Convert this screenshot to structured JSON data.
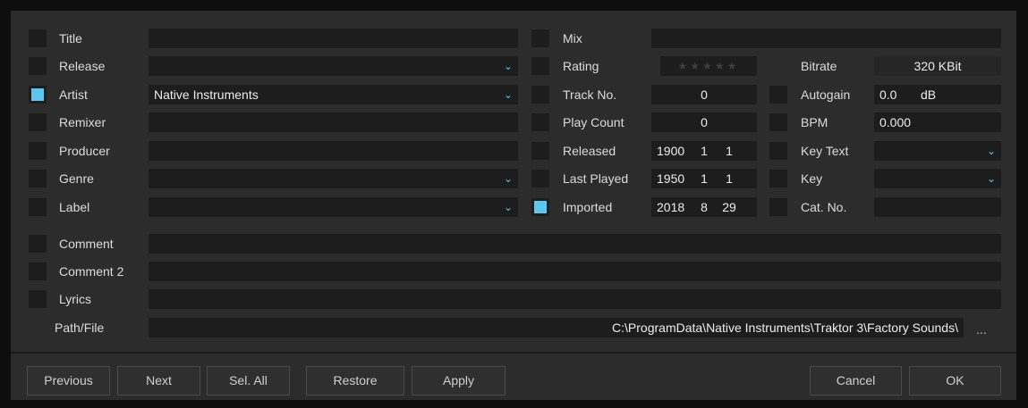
{
  "left_fields": [
    {
      "label": "Title",
      "value": "",
      "checked": false,
      "dropdown": false
    },
    {
      "label": "Release",
      "value": "",
      "checked": false,
      "dropdown": true
    },
    {
      "label": "Artist",
      "value": "Native Instruments",
      "checked": true,
      "dropdown": true
    },
    {
      "label": "Remixer",
      "value": "",
      "checked": false,
      "dropdown": false
    },
    {
      "label": "Producer",
      "value": "",
      "checked": false,
      "dropdown": false
    },
    {
      "label": "Genre",
      "value": "",
      "checked": false,
      "dropdown": true
    },
    {
      "label": "Label",
      "value": "",
      "checked": false,
      "dropdown": true
    }
  ],
  "mid_fields": [
    {
      "label": "Mix",
      "value": "",
      "checked": false
    },
    {
      "label": "Rating",
      "value": "★★★★★",
      "checked": false
    },
    {
      "label": "Track No.",
      "value": "0",
      "checked": false
    },
    {
      "label": "Play Count",
      "value": "0",
      "checked": false
    },
    {
      "label": "Released",
      "date": [
        "1900",
        "1",
        "1"
      ],
      "checked": false
    },
    {
      "label": "Last Played",
      "date": [
        "1950",
        "1",
        "1"
      ],
      "checked": false
    },
    {
      "label": "Imported",
      "date": [
        "2018",
        "8",
        "29"
      ],
      "checked": true
    }
  ],
  "right_fields": [
    {
      "label": "Bitrate",
      "value": "320 KBit",
      "checked": false,
      "has_checkbox": false
    },
    {
      "label": "Autogain",
      "value": "0.0",
      "unit": "dB",
      "checked": false,
      "has_checkbox": true
    },
    {
      "label": "BPM",
      "value": "0.000",
      "checked": false,
      "has_checkbox": true
    },
    {
      "label": "Key Text",
      "value": "",
      "checked": false,
      "has_checkbox": true,
      "dropdown": true
    },
    {
      "label": "Key",
      "value": "",
      "checked": false,
      "has_checkbox": true,
      "dropdown": true
    },
    {
      "label": "Cat. No.",
      "value": "",
      "checked": false,
      "has_checkbox": true
    }
  ],
  "comment_fields": [
    {
      "label": "Comment",
      "value": "",
      "checked": false
    },
    {
      "label": "Comment 2",
      "value": "",
      "checked": false
    },
    {
      "label": "Lyrics",
      "value": "",
      "checked": false
    }
  ],
  "path": {
    "label": "Path/File",
    "value": "C:\\ProgramData\\Native Instruments\\Traktor 3\\Factory Sounds\\",
    "browse": "..."
  },
  "buttons": {
    "previous": "Previous",
    "next": "Next",
    "sel_all": "Sel. All",
    "restore": "Restore",
    "apply": "Apply",
    "cancel": "Cancel",
    "ok": "OK"
  },
  "colors": {
    "accent": "#5cc8f2",
    "panel": "#2c2c2c",
    "field": "#1d1d1d"
  }
}
